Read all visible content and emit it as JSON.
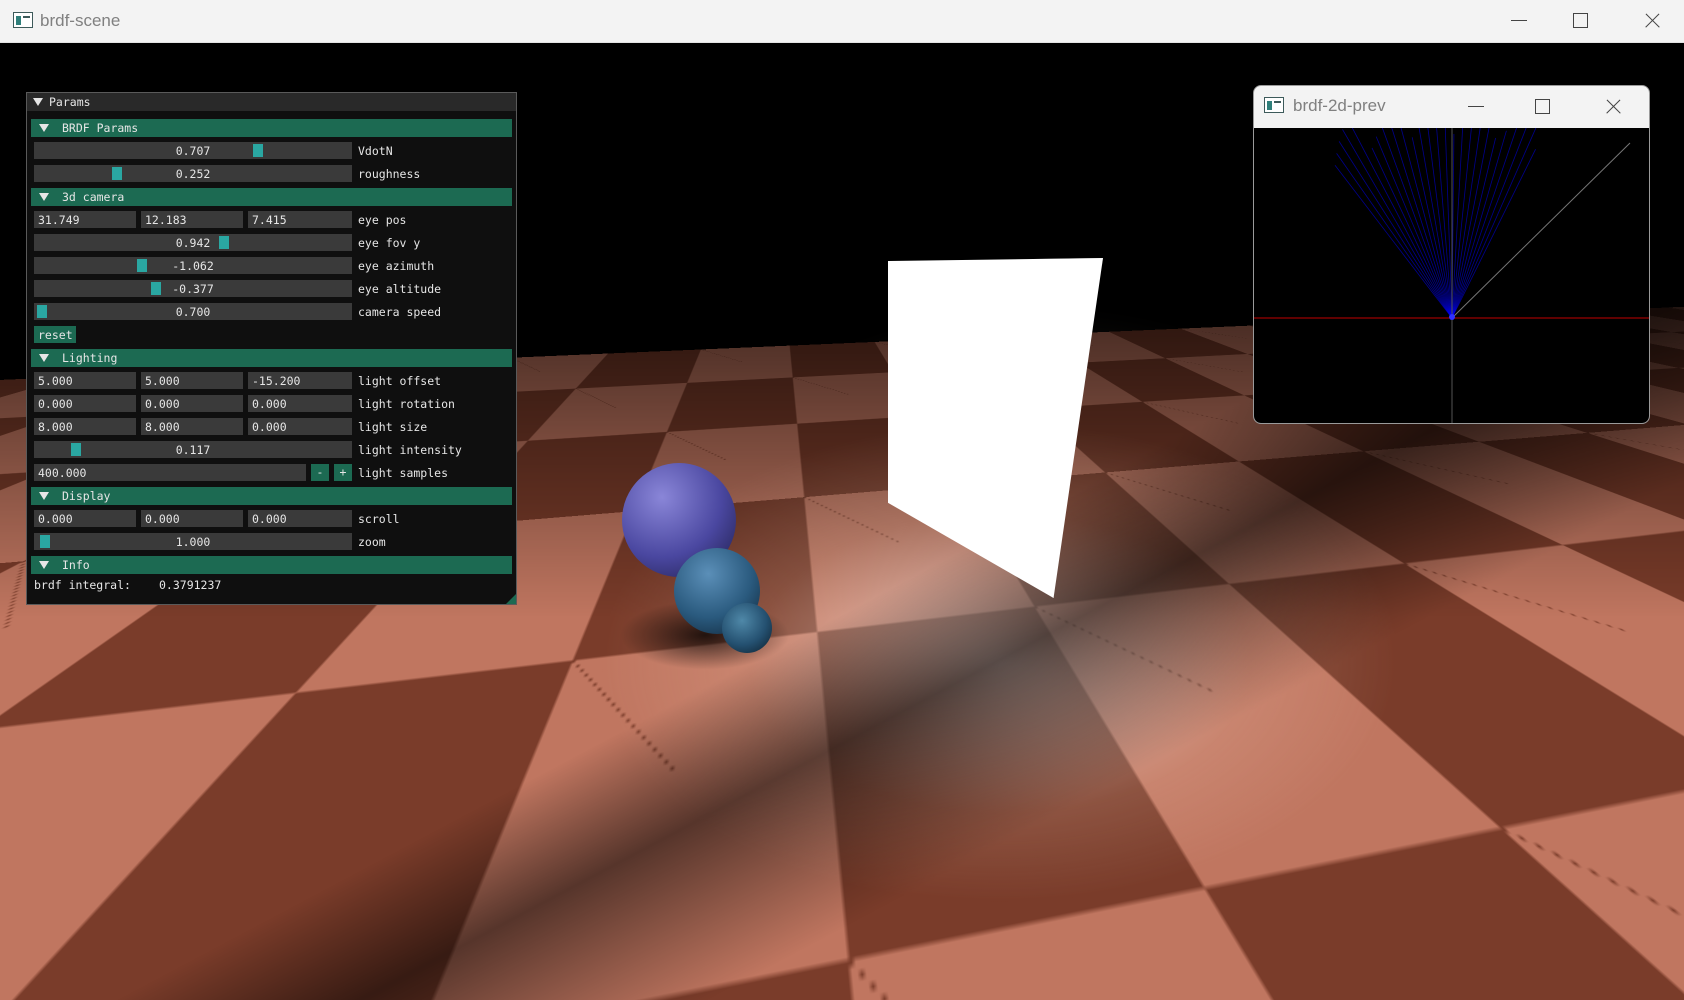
{
  "main_window": {
    "title": "brdf-scene"
  },
  "params_window": {
    "title": "Params",
    "brdf_params": {
      "header": "BRDF Params",
      "vdotn": {
        "value": "0.707",
        "label": "VdotN",
        "fraction": 0.707
      },
      "roughness": {
        "value": "0.252",
        "label": "roughness",
        "fraction": 0.252
      }
    },
    "camera": {
      "header": "3d camera",
      "eye_pos": {
        "x": "31.749",
        "y": "12.183",
        "z": "7.415",
        "label": "eye pos"
      },
      "eye_fov_y": {
        "value": "0.942",
        "label": "eye fov y",
        "fraction": 0.58
      },
      "eye_azimuth": {
        "value": "-1.062",
        "label": "eye azimuth",
        "fraction": 0.33
      },
      "eye_altitude": {
        "value": "-0.377",
        "label": "eye altitude",
        "fraction": 0.38
      },
      "camera_speed": {
        "value": "0.700",
        "label": "camera speed",
        "fraction": 0.0
      },
      "reset_label": "reset"
    },
    "lighting": {
      "header": "Lighting",
      "light_offset": {
        "x": "5.000",
        "y": "5.000",
        "z": "-15.200",
        "label": "light offset"
      },
      "light_rotation": {
        "x": "0.000",
        "y": "0.000",
        "z": "0.000",
        "label": "light rotation"
      },
      "light_size": {
        "x": "8.000",
        "y": "8.000",
        "z": "0.000",
        "label": "light size"
      },
      "light_intensity": {
        "value": "0.117",
        "label": "light intensity",
        "fraction": 0.117
      },
      "light_samples": {
        "value": "400.000",
        "label": "light samples",
        "minus": "-",
        "plus": "+"
      }
    },
    "display": {
      "header": "Display",
      "scroll": {
        "x": "0.000",
        "y": "0.000",
        "z": "0.000",
        "label": "scroll"
      },
      "zoom": {
        "value": "1.000",
        "label": "zoom",
        "fraction": 0.01
      }
    },
    "info": {
      "header": "Info",
      "brdf_integral_label": "brdf integral:",
      "brdf_integral_value": "0.3791237"
    }
  },
  "preview_window": {
    "title": "brdf-2d-prev"
  },
  "colors": {
    "section_header": "#1c6a52",
    "slider_grab": "#2aa7a2",
    "floor_light": "#c07660",
    "floor_dark": "#7a3c2a",
    "lobe": "#0000ff",
    "horizon_line": "#c00000"
  }
}
